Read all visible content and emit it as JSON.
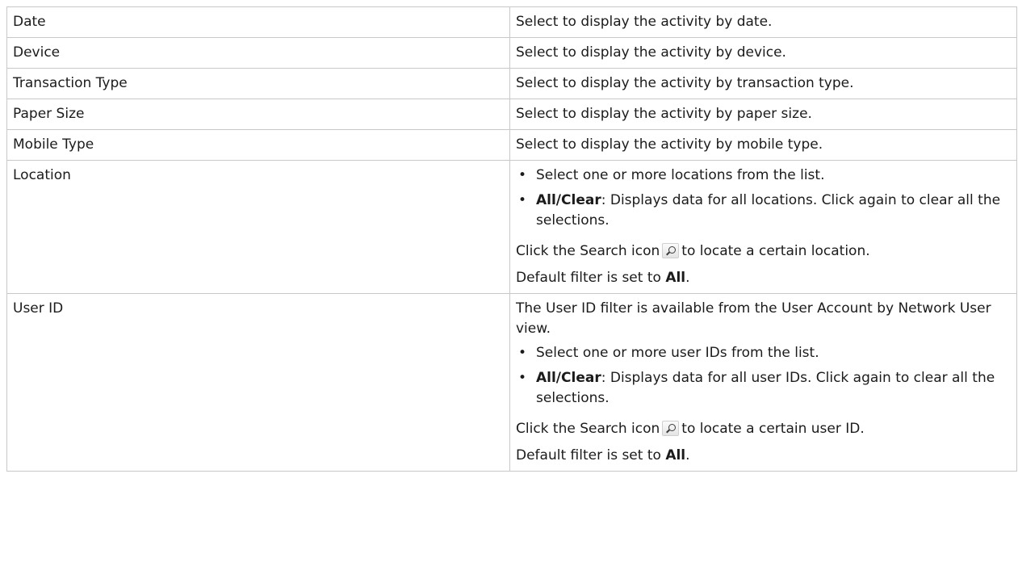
{
  "rows": [
    {
      "label": "Date",
      "description": "Select to display the activity by date."
    },
    {
      "label": "Device",
      "description": "Select to display the activity by device."
    },
    {
      "label": "Transaction Type",
      "description": "Select to display the activity by transaction type."
    },
    {
      "label": "Paper Size",
      "description": "Select to display the activity by paper size."
    },
    {
      "label": "Mobile Type",
      "description": "Select to display the activity by mobile type."
    }
  ],
  "location": {
    "label": "Location",
    "bullet1": "Select one or more locations from the list.",
    "bullet2_strong": "All/Clear",
    "bullet2_rest": ": Displays data for all locations. Click again to clear all the selections.",
    "search_before": "Click the Search icon",
    "search_after": "to locate a certain location.",
    "default_before": "Default filter is set to ",
    "default_strong": "All",
    "default_after": "."
  },
  "user_id": {
    "label": "User ID",
    "intro": "The User ID filter is available from the User Account by Network User view.",
    "bullet1": "Select one or more user IDs from the list.",
    "bullet2_strong": "All/Clear",
    "bullet2_rest": ": Displays data for all user IDs. Click again to clear all the selections.",
    "search_before": "Click the Search icon",
    "search_after": "to locate a certain user ID.",
    "default_before": "Default filter is set to ",
    "default_strong": "All",
    "default_after": "."
  },
  "bullet_glyph": "•",
  "icons": {
    "search": "search-icon"
  }
}
